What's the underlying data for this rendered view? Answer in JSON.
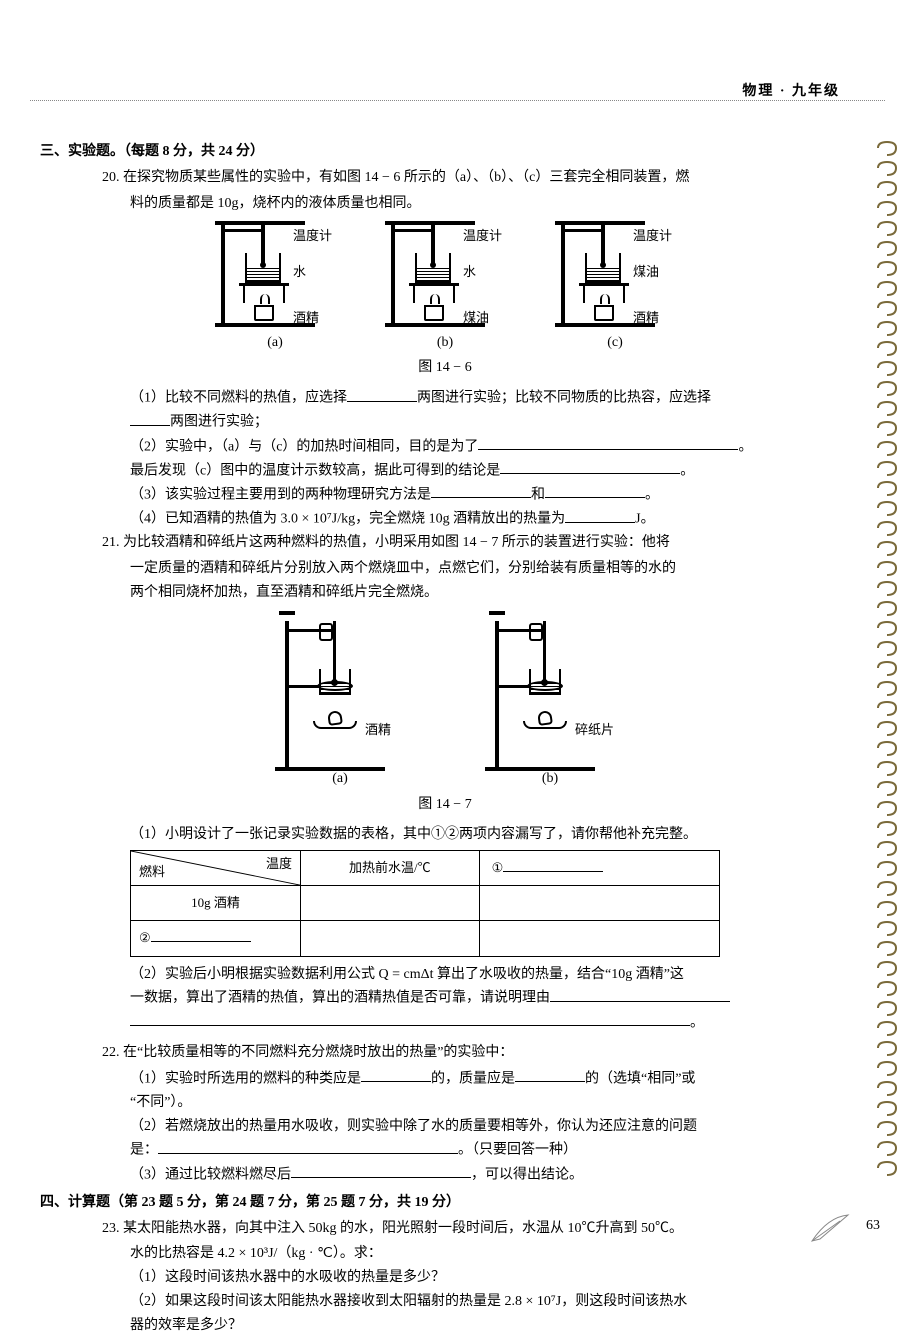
{
  "header": {
    "label": "物理 · 九年级"
  },
  "page_number": "63",
  "section3": {
    "title": "三、实验题。（每题 8 分，共 24 分）",
    "q20": {
      "num": "20.",
      "stem1": "在探究物质某些属性的实验中，有如图 14 − 6 所示的（a）、（b）、（c）三套完全相同装置，燃",
      "stem2": "料的质量都是 10g，烧杯内的液体质量也相同。",
      "fig": {
        "caption": "图 14 − 6",
        "a": {
          "therm": "温度计",
          "liquid": "水",
          "fuel": "酒精",
          "sub": "(a)"
        },
        "b": {
          "therm": "温度计",
          "liquid": "水",
          "fuel": "煤油",
          "sub": "(b)"
        },
        "c": {
          "therm": "温度计",
          "liquid": "煤油",
          "fuel": "酒精",
          "sub": "(c)"
        }
      },
      "p1a": "（1）比较不同燃料的热值，应选择",
      "p1b": "两图进行实验；比较不同物质的比热容，应选择",
      "p1c": "两图进行实验；",
      "p2a": "（2）实验中，（a）与（c）的加热时间相同，目的是为了",
      "p2b": "。",
      "p2c": "最后发现（c）图中的温度计示数较高，据此可得到的结论是",
      "p2d": "。",
      "p3a": "（3）该实验过程主要用到的两种物理研究方法是",
      "p3b": "和",
      "p3c": "。",
      "p4a": "（4）已知酒精的热值为 3.0 × 10⁷J/kg，完全燃烧 10g 酒精放出的热量为",
      "p4b": "J。"
    },
    "q21": {
      "num": "21.",
      "stem1": "为比较酒精和碎纸片这两种燃料的热值，小明采用如图 14 − 7 所示的装置进行实验：他将",
      "stem2": "一定质量的酒精和碎纸片分别放入两个燃烧皿中，点燃它们，分别给装有质量相等的水的",
      "stem3": "两个相同烧杯加热，直至酒精和碎纸片完全燃烧。",
      "fig": {
        "caption": "图 14 − 7",
        "a_label": "酒精",
        "a_sub": "(a)",
        "b_label": "碎纸片",
        "b_sub": "(b)"
      },
      "p1": "（1）小明设计了一张记录实验数据的表格，其中①②两项内容漏写了，请你帮他补充完整。",
      "table": {
        "diag_top": "温度",
        "diag_left": "燃料",
        "col2": "加热前水温/℃",
        "col3": "①",
        "row2c1": "10g 酒精",
        "row3c1": "②"
      },
      "p2a": "（2）实验后小明根据实验数据利用公式 Q = cmΔt 算出了水吸收的热量，结合“10g 酒精”这",
      "p2b": "一数据，算出了酒精的热值，算出的酒精热值是否可靠，请说明理由",
      "p2c": "。"
    },
    "q22": {
      "num": "22.",
      "stem": "在“比较质量相等的不同燃料充分燃烧时放出的热量”的实验中：",
      "p1a": "（1）实验时所选用的燃料的种类应是",
      "p1b": "的，质量应是",
      "p1c": "的（选填“相同”或",
      "p1d": "“不同”）。",
      "p2a": "（2）若燃烧放出的热量用水吸收，则实验中除了水的质量要相等外，你认为还应注意的问题",
      "p2b": "是：",
      "p2c": "。（只要回答一种）",
      "p3a": "（3）通过比较燃料燃尽后",
      "p3b": "，可以得出结论。"
    }
  },
  "section4": {
    "title": "四、计算题（第 23 题 5 分，第 24 题 7 分，第 25 题 7 分，共 19 分）",
    "q23": {
      "num": "23.",
      "stem1": "某太阳能热水器，向其中注入 50kg 的水，阳光照射一段时间后，水温从 10℃升高到 50℃。",
      "stem2": "水的比热容是 4.2 × 10³J/（kg · ℃）。求：",
      "p1": "（1）这段时间该热水器中的水吸收的热量是多少？",
      "p2a": "（2）如果这段时间该太阳能热水器接收到太阳辐射的热量是 2.8 × 10⁷J，则这段时间该热水",
      "p2b": "器的效率是多少？"
    }
  }
}
